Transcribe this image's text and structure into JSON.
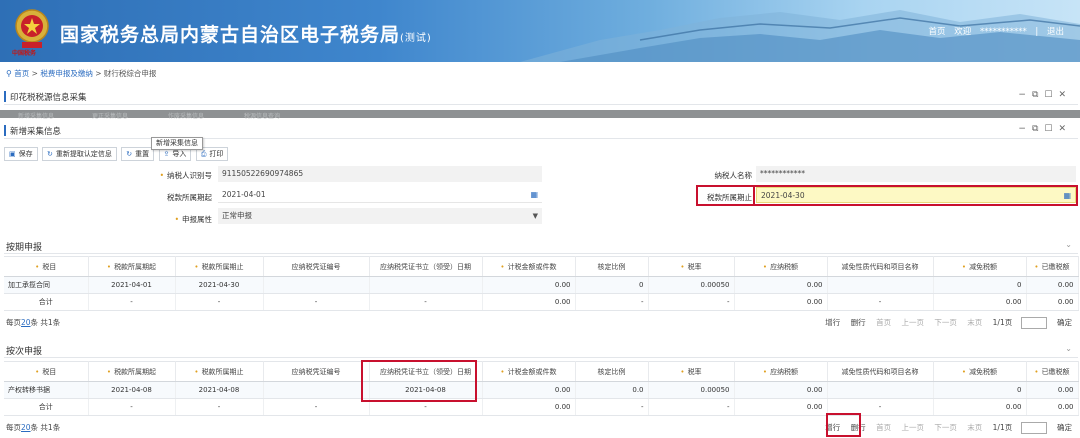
{
  "header": {
    "emblem_caption": "中国税务",
    "title": "国家税务总局内蒙古自治区电子税务局",
    "title_tag": "(测试)",
    "home_link": "首页",
    "welcome": "欢迎",
    "username": "***********",
    "separator": "|",
    "logout": "退出"
  },
  "breadcrumb": {
    "home": "首页",
    "sep1": ">",
    "level1": "税费申报及缴纳",
    "sep2": ">",
    "current": "财行税综合申报"
  },
  "panel1": {
    "title": "印花税税源信息采集"
  },
  "ghost_buttons": [
    "新增采集信息",
    "更正采集信息",
    "作废采集信息",
    "税源信息查询"
  ],
  "panel2": {
    "title": "新增采集信息"
  },
  "window_controls": {
    "minimize": "−",
    "restore": "⧉",
    "maximize": "☐",
    "close": "✕"
  },
  "toolbar": {
    "save": "保存",
    "refetch": "重新提取认定信息",
    "reset": "重置",
    "import": "导入",
    "print": "打印",
    "tooltip": "新增采集信息"
  },
  "form": {
    "taxpayer_id_label": "纳税人识别号",
    "taxpayer_id_value": "91150522690974865",
    "taxpayer_name_label": "纳税人名称",
    "taxpayer_name_value": "************",
    "period_start_label": "税款所属期起",
    "period_start_value": "2021-04-01",
    "period_end_label": "税款所属期止",
    "period_end_value": "2021-04-30",
    "attr_label": "申报属性",
    "attr_value": "正常申报"
  },
  "grid_headers": [
    "税目",
    "税款所属期起",
    "税款所属期止",
    "应纳税凭证编号",
    "应纳税凭证书立（领受）日期",
    "计税金额或件数",
    "核定比例",
    "税率",
    "应纳税额",
    "减免性质代码和项目名称",
    "减免税额",
    "已缴税额"
  ],
  "grid_required": [
    true,
    true,
    true,
    false,
    false,
    true,
    false,
    true,
    true,
    false,
    true,
    true
  ],
  "section1": {
    "title": "按期申报",
    "row": [
      "加工承揽合同",
      "2021-04-01",
      "2021-04-30",
      "",
      "",
      "0.00",
      "0",
      "0.00050",
      "0.00",
      "",
      "0",
      "0.00"
    ],
    "total": [
      "合计",
      "-",
      "-",
      "-",
      "-",
      "0.00",
      "-",
      "-",
      "0.00",
      "-",
      "0.00",
      "0.00"
    ]
  },
  "section2": {
    "title": "按次申报",
    "row": [
      "产权转移书据",
      "2021-04-08",
      "2021-04-08",
      "",
      "2021-04-08",
      "0.00",
      "0.0",
      "0.00050",
      "0.00",
      "",
      "0",
      "0.00"
    ],
    "total": [
      "合计",
      "-",
      "-",
      "-",
      "-",
      "0.00",
      "-",
      "-",
      "0.00",
      "-",
      "0.00",
      "0.00"
    ]
  },
  "pager": {
    "per_page_prefix": "每页",
    "per_page": "20",
    "per_page_suffix": "条 共1条",
    "add_row": "增行",
    "delete_row": "删行",
    "first": "首页",
    "prev": "上一页",
    "next": "下一页",
    "last": "末页",
    "page_info": "1/1页",
    "confirm": "确定"
  }
}
